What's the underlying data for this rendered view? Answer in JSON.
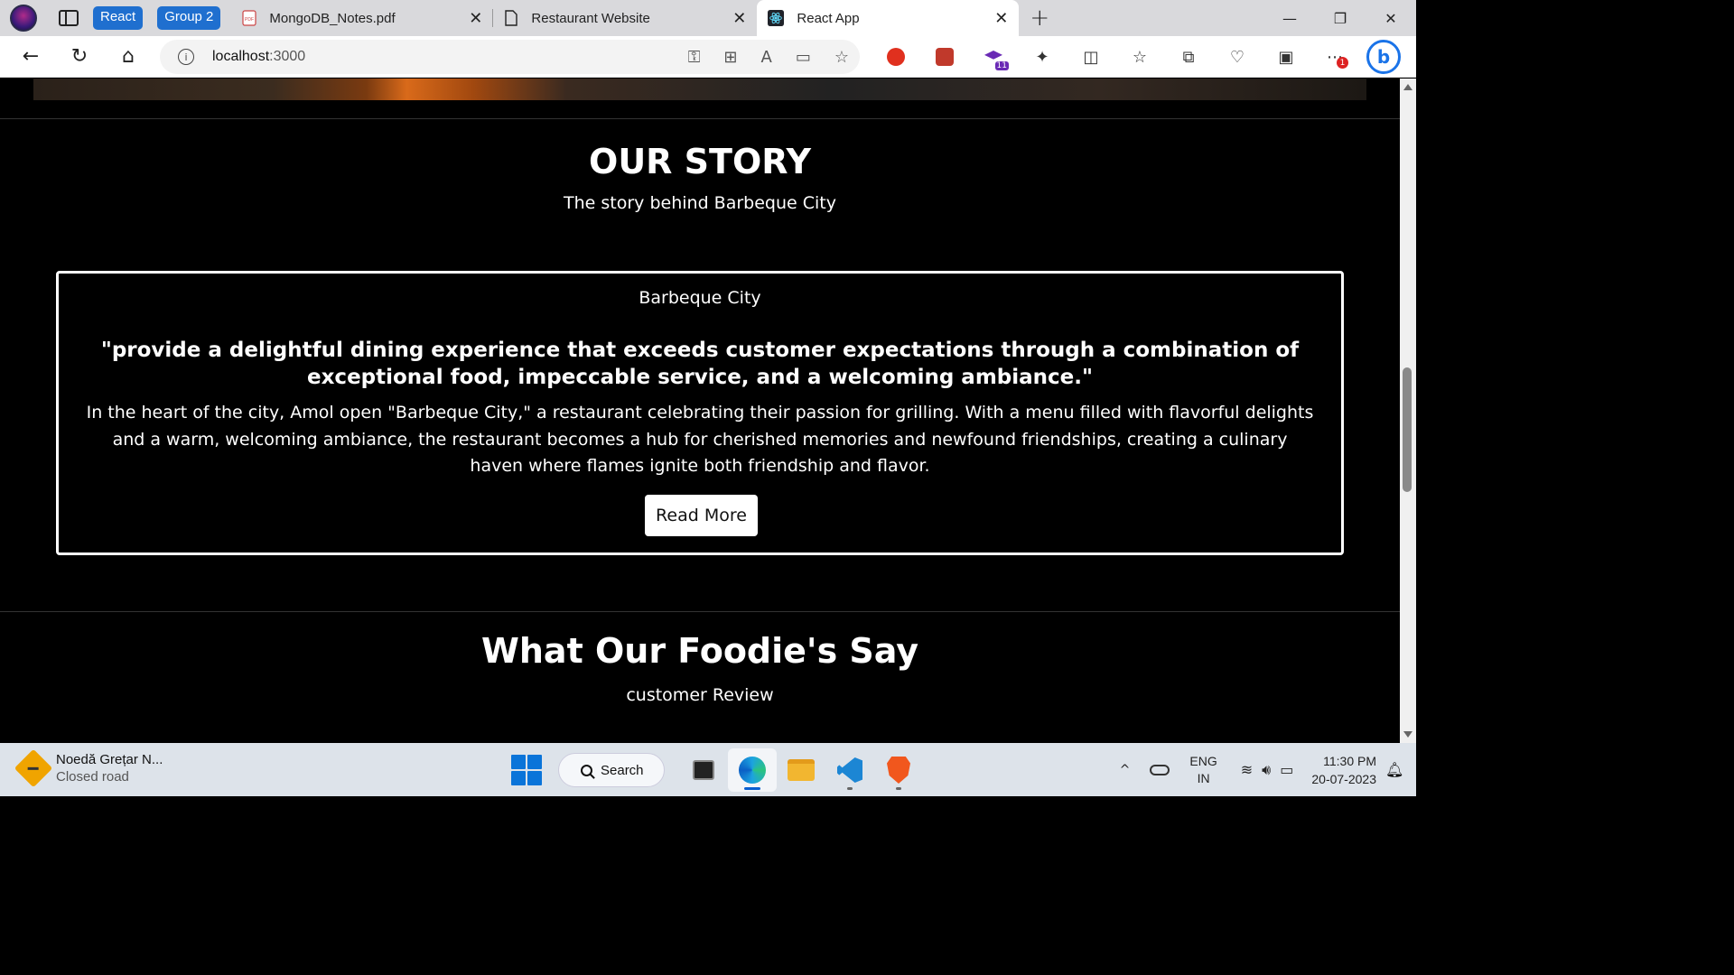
{
  "browser": {
    "tab_groups": [
      {
        "label": "React",
        "color": "#1f6fcf"
      },
      {
        "label": "Group 2",
        "color": "#1f6fcf"
      }
    ],
    "tabs": [
      {
        "title": "MongoDB_Notes.pdf",
        "icon": "pdf-icon"
      },
      {
        "title": "Restaurant Website",
        "icon": "page-icon"
      },
      {
        "title": "React App",
        "icon": "react-icon",
        "active": true
      }
    ],
    "new_tab": "+",
    "address": {
      "host": "localhost",
      "port": ":3000"
    },
    "window_controls": {
      "minimize": "—",
      "restore": "❐",
      "close": "✕"
    }
  },
  "page": {
    "story": {
      "heading": "OUR STORY",
      "subheading": "The story behind Barbeque City",
      "card_title": "Barbeque City",
      "quote": "\"provide a delightful dining experience that exceeds customer expectations through a combination of exceptional food, impeccable service, and a welcoming ambiance.\"",
      "body": "In the heart of the city, Amol open \"Barbeque City,\" a restaurant celebrating their passion for grilling. With a menu filled with flavorful delights and a warm, welcoming ambiance, the restaurant becomes a hub for cherished memories and newfound friendships, creating a culinary haven where flames ignite both friendship and flavor.",
      "button": "Read More"
    },
    "reviews": {
      "heading": "What Our Foodie's Say",
      "subheading": "customer Review"
    }
  },
  "taskbar": {
    "weather": {
      "line1": "Noedă Grețar N...",
      "line2": "Closed road"
    },
    "search_label": "Search",
    "lang": {
      "line1": "ENG",
      "line2": "IN"
    },
    "clock": {
      "time": "11:30 PM",
      "date": "20-07-2023"
    },
    "extension_badge": "11",
    "menu_badge": "1"
  },
  "colors": {
    "group_chip": "#1f6fcf",
    "page_bg": "#000000",
    "accent_blue": "#1a73e8"
  }
}
